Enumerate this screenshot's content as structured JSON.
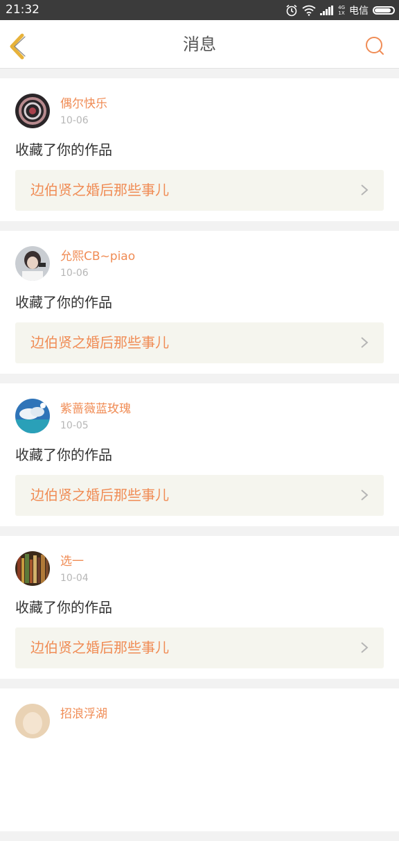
{
  "status_bar": {
    "time": "21:32",
    "network_top": "4G",
    "network_bottom": "1X",
    "carrier": "电信",
    "battery_level": 0.9
  },
  "header": {
    "title": "消息",
    "back_icon": "chevron-left-icon",
    "search_icon": "search-icon"
  },
  "colors": {
    "accent": "#f08c55",
    "back_arrow": "#e7b23a",
    "work_bg": "#f5f5ee"
  },
  "messages": [
    {
      "username": "偶尔快乐",
      "date": "10-06",
      "action": "收藏了你的作品",
      "work_title": "边伯贤之婚后那些事儿"
    },
    {
      "username": "允熙CB~piao",
      "date": "10-06",
      "action": "收藏了你的作品",
      "work_title": "边伯贤之婚后那些事儿"
    },
    {
      "username": "紫蔷薇蓝玫瑰",
      "date": "10-05",
      "action": "收藏了你的作品",
      "work_title": "边伯贤之婚后那些事儿"
    },
    {
      "username": "选一",
      "date": "10-04",
      "action": "收藏了你的作品",
      "work_title": "边伯贤之婚后那些事儿"
    },
    {
      "username": "招浪浮湖",
      "date": "",
      "action": "",
      "work_title": ""
    }
  ]
}
